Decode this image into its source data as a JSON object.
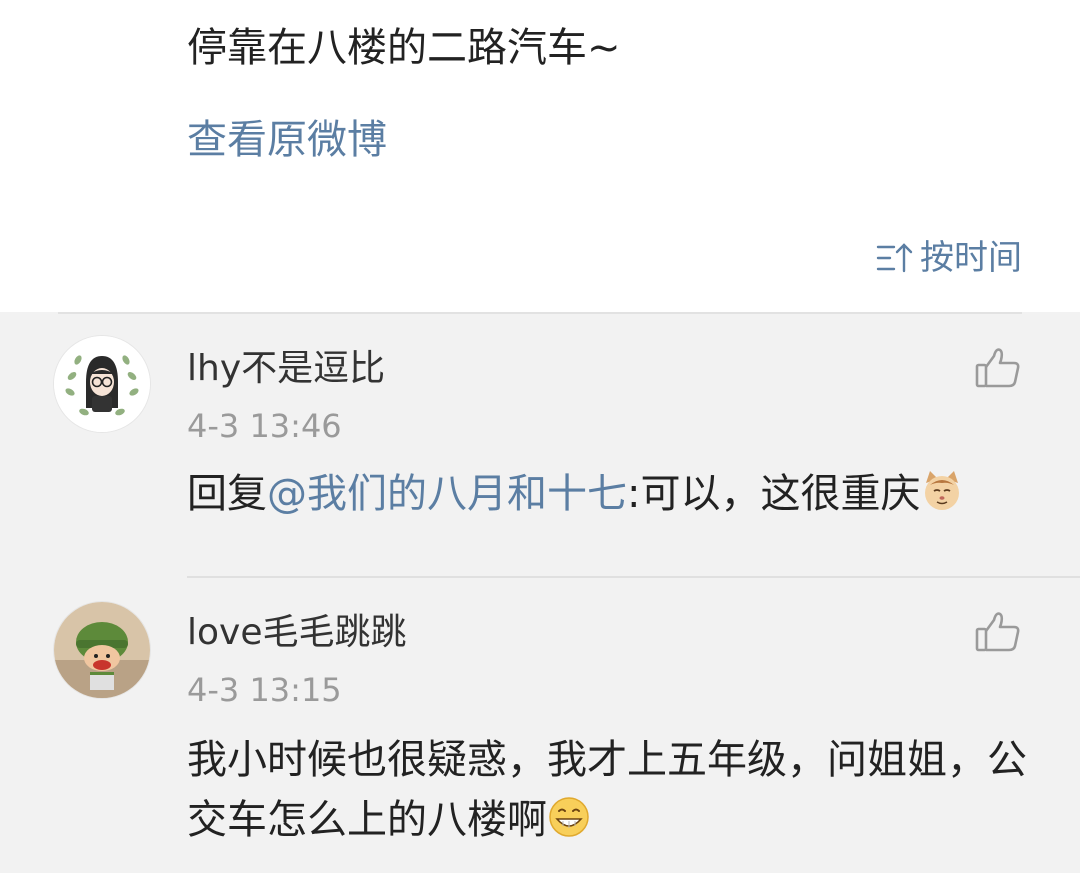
{
  "post": {
    "text": "停靠在八楼的二路汽车~",
    "view_original": "查看原微博"
  },
  "sort": {
    "icon": "sort-icon",
    "label": "按时间"
  },
  "comments": [
    {
      "username": "lhy不是逗比",
      "time": "4-3 13:46",
      "prefix": "回复",
      "mention": "@我们的八月和十七",
      "text": ":可以，这很重庆",
      "emoji": "cat-face-emoji",
      "like_icon": "thumbs-up-icon"
    },
    {
      "username": "love毛毛跳跳",
      "time": "4-3 13:15",
      "text": "我小时候也很疑惑，我才上五年级，问姐姐，公交车怎么上的八楼啊",
      "emoji": "grinning-face-emoji",
      "like_icon": "thumbs-up-icon"
    }
  ],
  "colors": {
    "link": "#5b7ea3",
    "comments_bg": "#f2f2f2",
    "timestamp": "#9a9a9a"
  }
}
